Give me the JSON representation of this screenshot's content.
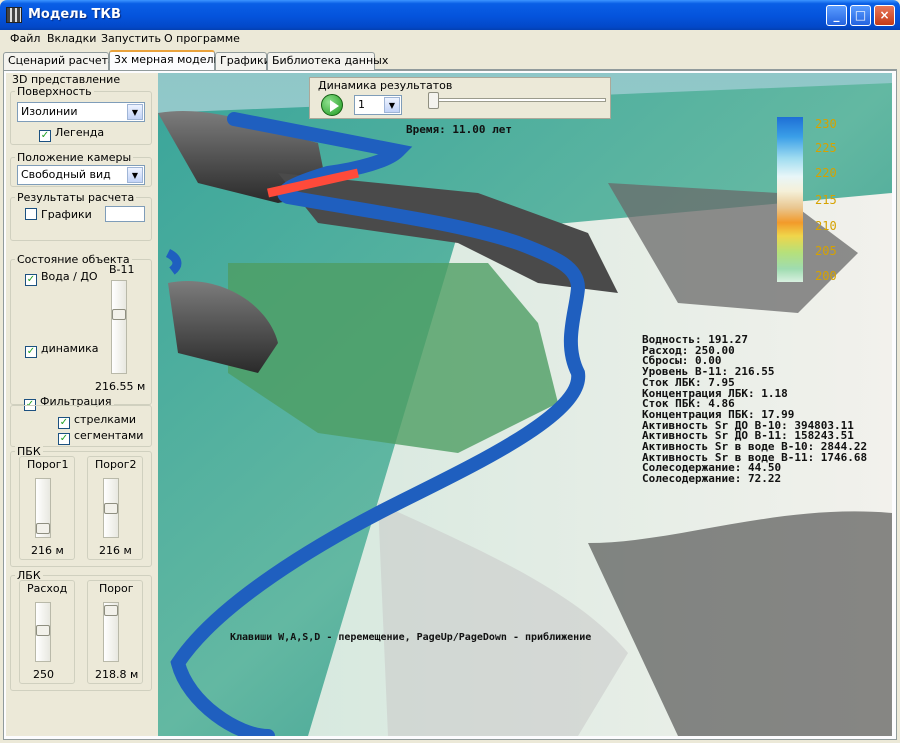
{
  "window": {
    "title": "Модель ТКВ"
  },
  "menu": [
    "Файл",
    "Вкладки",
    "Запустить",
    "О программе"
  ],
  "tabs": [
    "Сценарий расчета",
    "3х мерная модель",
    "Графики",
    "Библиотека данных"
  ],
  "left": {
    "section_title": "3D представление",
    "surface": {
      "label": "Поверхность",
      "value": "Изолинии",
      "legend_label": "Легенда",
      "legend_checked": true
    },
    "camera": {
      "label": "Положение камеры",
      "value": "Свободный вид"
    },
    "results": {
      "label": "Результаты расчета",
      "graphs_label": "Графики",
      "graphs_checked": false
    },
    "state": {
      "label": "Состояние объекта",
      "water_label": "Вода / ДО",
      "dynamics_label": "динамика",
      "filtration_label": "Фильтрация",
      "slider_label": "В-11",
      "slider_value": "216.55 м",
      "arrows_label": "стрелками",
      "segments_label": "сегментами"
    },
    "pbk": {
      "label": "ПБК",
      "threshold1": "Порог1",
      "threshold2": "Порог2",
      "value1": "216 м",
      "value2": "216 м"
    },
    "lbk": {
      "label": "ЛБК",
      "flow": "Расход",
      "threshold": "Порог",
      "value1": "250",
      "value2": "218.8 м"
    }
  },
  "dynamics": {
    "label": "Динамика результатов",
    "step_value": "1"
  },
  "scene": {
    "time": "Время: 11.00 лет",
    "hint": "Клавиши W,A,S,D - перемещение, PageUp/PageDown - приближение",
    "readout": [
      "Водность: 191.27",
      "Расход: 250.00",
      "Сбросы: 0.00",
      "Уровень В-11: 216.55",
      "Сток ЛБК: 7.95",
      "Концентрация ЛБК: 1.18",
      "Сток ПБК: 4.86",
      "Концентрация ПБК: 17.99",
      "Активность Sr ДО В-10: 394803.11",
      "Активность Sr ДО В-11: 158243.51",
      "Активность Sr в воде В-10: 2844.22",
      "Активность Sr в воде В-11: 1746.68",
      "Солесодержание: 44.50",
      "Солесодержание: 72.22"
    ],
    "legend_ticks": [
      "230",
      "225",
      "220",
      "215",
      "210",
      "205",
      "200"
    ]
  },
  "colors": {
    "river": "#1f5fbf",
    "water_red": "#ff4a3a",
    "titlebar": "#0453dc"
  }
}
